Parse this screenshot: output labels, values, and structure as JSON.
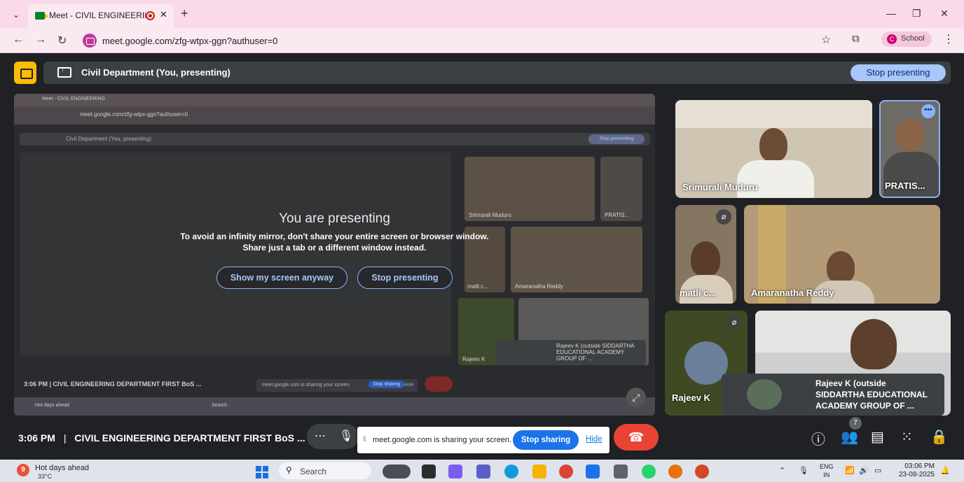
{
  "browser": {
    "tab_title": "Meet - CIVIL ENGINEERING",
    "url": "meet.google.com/zfg-wtpx-ggn?authuser=0",
    "profile_initial": "C",
    "profile_name": "School"
  },
  "presenting_banner": {
    "label": "Civil Department (You, presenting)",
    "stop_button": "Stop presenting"
  },
  "mirror": {
    "tab_title": "Meet - CIVIL ENGINEERING",
    "url": "meet.google.com/zfg-wtpx-ggn?authuser=0",
    "banner_label": "Civil Department (You, presenting)",
    "stop_button": "Stop presenting",
    "footer": "3:06 PM  |  CIVIL ENGINEERING DEPARTMENT FIRST BoS ...",
    "share_msg": "meet.google.com is sharing your screen.",
    "share_stop": "Stop sharing",
    "share_hide": "Hide",
    "weather": "Hot days ahead",
    "search": "Search",
    "tiles": [
      "Srimurali Muduru",
      "PRATIS...",
      "matli c...",
      "Amaranatha Reddy",
      "Rajeev K"
    ],
    "outside": "Rajeev K (outside SIDDARTHA EDUCATIONAL ACADEMY GROUP OF ..."
  },
  "presenting_dialog": {
    "title": "You are presenting",
    "line1": "To avoid an infinity mirror, don't share your entire screen or browser window.",
    "line2": "Share just a tab or a different window instead.",
    "show_anyway": "Show my screen anyway",
    "stop": "Stop presenting"
  },
  "participants": [
    {
      "name": "Srimurali Muduru",
      "muted": false
    },
    {
      "name": "PRATIS...",
      "muted": false
    },
    {
      "name": "matli c...",
      "muted": true
    },
    {
      "name": "Amaranatha Reddy",
      "muted": false
    },
    {
      "name": "Rajeev K",
      "muted": true
    }
  ],
  "outside_card": {
    "line1": "Rajeev K (outside",
    "line2": "SIDDARTHA EDUCATIONAL",
    "line3": "ACADEMY GROUP OF ..."
  },
  "meetbar": {
    "time": "3:06 PM",
    "meeting_title": "CIVIL ENGINEERING DEPARTMENT FIRST BoS ...",
    "share_msg": "meet.google.com is sharing your screen.",
    "stop_sharing": "Stop sharing",
    "hide": "Hide",
    "people_count": "7"
  },
  "taskbar": {
    "weather_badge": "9",
    "weather_title": "Hot days ahead",
    "temperature": "33°C",
    "search": "Search",
    "lang1": "ENG",
    "lang2": "IN",
    "time": "03:06 PM",
    "date": "23-08-2025"
  }
}
